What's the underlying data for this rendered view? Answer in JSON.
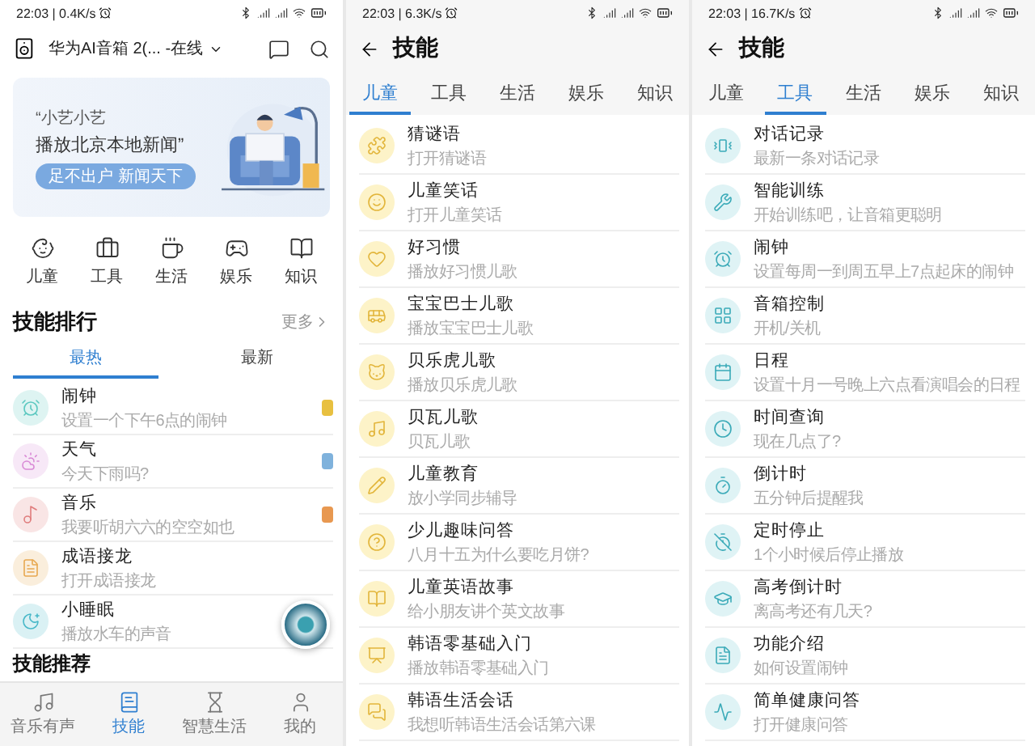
{
  "screens": [
    {
      "kind": "home",
      "status": {
        "time": "22:03 | 0.4K/s"
      },
      "device": {
        "name": "华为AI音箱 2(... -在线"
      },
      "banner": {
        "quote": "“小艺小艺",
        "headline": "播放北京本地新闻”",
        "pill": "足不出户 新闻天下"
      },
      "categories": [
        {
          "label": "儿童"
        },
        {
          "label": "工具"
        },
        {
          "label": "生活"
        },
        {
          "label": "娱乐"
        },
        {
          "label": "知识"
        }
      ],
      "ranking": {
        "title": "技能排行",
        "more": "更多",
        "tabs": [
          {
            "label": "最热",
            "selected": true
          },
          {
            "label": "最新",
            "selected": false
          }
        ],
        "items": [
          {
            "title": "闹钟",
            "subtitle": "设置一个下午6点的闹钟",
            "color": "#5cc8c0",
            "medal": {
              "color": "#e8c040"
            }
          },
          {
            "title": "天气",
            "subtitle": "今天下雨吗?",
            "color": "#d98ad6",
            "medal": {
              "color": "#7fb2dc"
            }
          },
          {
            "title": "音乐",
            "subtitle": "我要听胡六六的空空如也",
            "color": "#e07d7d",
            "medal": {
              "color": "#e89850"
            }
          },
          {
            "title": "成语接龙",
            "subtitle": "打开成语接龙",
            "color": "#e8a850"
          },
          {
            "title": "小睡眠",
            "subtitle": "播放水车的声音",
            "color": "#48b8c8"
          }
        ]
      },
      "recommend_title": "技能推荐",
      "bottom_nav": [
        {
          "label": "音乐有声",
          "selected": false
        },
        {
          "label": "技能",
          "selected": true
        },
        {
          "label": "智慧生活",
          "selected": false
        },
        {
          "label": "我的",
          "selected": false
        }
      ]
    },
    {
      "kind": "list",
      "status": {
        "time": "22:03 | 6.3K/s"
      },
      "title": "技能",
      "tabs": [
        {
          "label": "儿童",
          "selected": true
        },
        {
          "label": "工具",
          "selected": false
        },
        {
          "label": "生活",
          "selected": false
        },
        {
          "label": "娱乐",
          "selected": false
        },
        {
          "label": "知识",
          "selected": false
        }
      ],
      "items": [
        {
          "title": "猜谜语",
          "subtitle": "打开猜谜语"
        },
        {
          "title": "儿童笑话",
          "subtitle": "打开儿童笑话"
        },
        {
          "title": "好习惯",
          "subtitle": "播放好习惯儿歌"
        },
        {
          "title": "宝宝巴士儿歌",
          "subtitle": "播放宝宝巴士儿歌"
        },
        {
          "title": "贝乐虎儿歌",
          "subtitle": "播放贝乐虎儿歌"
        },
        {
          "title": "贝瓦儿歌",
          "subtitle": "贝瓦儿歌"
        },
        {
          "title": "儿童教育",
          "subtitle": "放小学同步辅导"
        },
        {
          "title": "少儿趣味问答",
          "subtitle": "八月十五为什么要吃月饼?"
        },
        {
          "title": "儿童英语故事",
          "subtitle": "给小朋友讲个英文故事"
        },
        {
          "title": "韩语零基础入门",
          "subtitle": "播放韩语零基础入门"
        },
        {
          "title": "韩语生活会话",
          "subtitle": "我想听韩语生活会话第六课"
        }
      ]
    },
    {
      "kind": "list",
      "status": {
        "time": "22:03 | 16.7K/s"
      },
      "title": "技能",
      "tabs": [
        {
          "label": "儿童",
          "selected": false
        },
        {
          "label": "工具",
          "selected": true
        },
        {
          "label": "生活",
          "selected": false
        },
        {
          "label": "娱乐",
          "selected": false
        },
        {
          "label": "知识",
          "selected": false
        }
      ],
      "items": [
        {
          "title": "对话记录",
          "subtitle": "最新一条对话记录"
        },
        {
          "title": "智能训练",
          "subtitle": "开始训练吧，让音箱更聪明"
        },
        {
          "title": "闹钟",
          "subtitle": "设置每周一到周五早上7点起床的闹钟"
        },
        {
          "title": "音箱控制",
          "subtitle": "开机/关机"
        },
        {
          "title": "日程",
          "subtitle": "设置十月一号晚上六点看演唱会的日程"
        },
        {
          "title": "时间查询",
          "subtitle": "现在几点了?"
        },
        {
          "title": "倒计时",
          "subtitle": "五分钟后提醒我"
        },
        {
          "title": "定时停止",
          "subtitle": "1个小时候后停止播放"
        },
        {
          "title": "高考倒计时",
          "subtitle": "离高考还有几天?"
        },
        {
          "title": "功能介绍",
          "subtitle": "如何设置闹钟"
        },
        {
          "title": "简单健康问答",
          "subtitle": "打开健康问答"
        }
      ]
    }
  ]
}
